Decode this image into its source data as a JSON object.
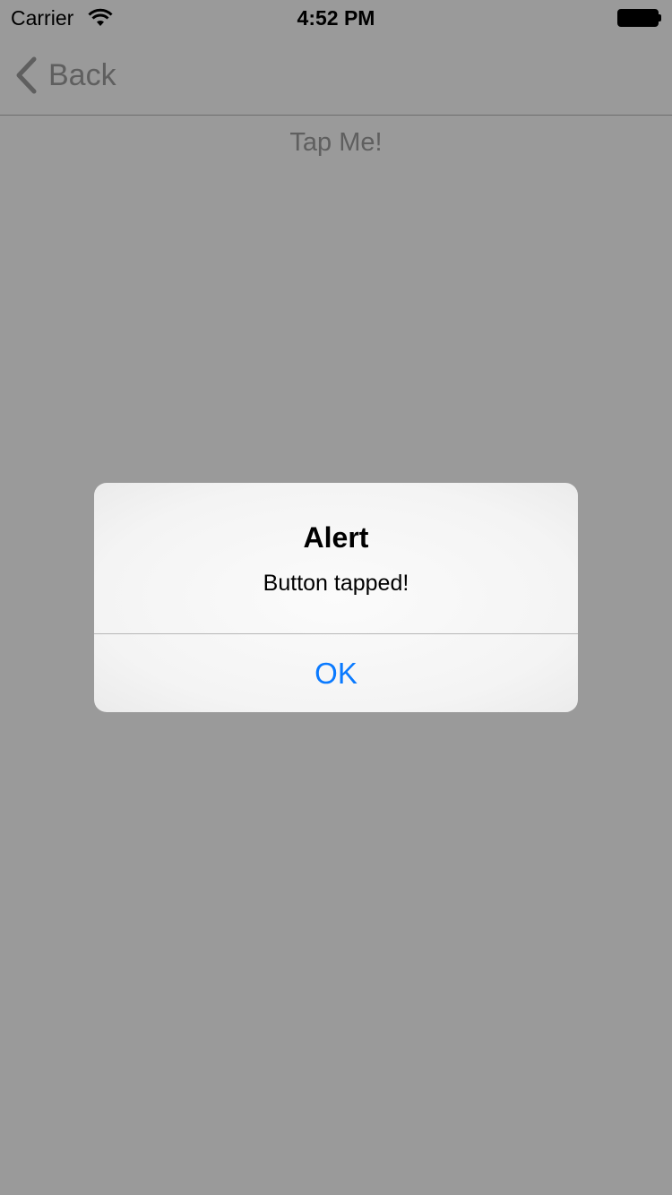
{
  "status_bar": {
    "carrier": "Carrier",
    "time": "4:52 PM",
    "wifi_icon": "wifi-icon",
    "battery_icon": "battery-icon"
  },
  "nav_bar": {
    "back_label": "Back",
    "back_icon": "chevron-left-icon"
  },
  "main": {
    "tap_me_label": "Tap Me!"
  },
  "alert": {
    "title": "Alert",
    "message": "Button tapped!",
    "ok_label": "OK"
  },
  "colors": {
    "dimmed_background": "#9a9a9a",
    "alert_background": "#f7f7f7",
    "ios_blue": "#0a7aff",
    "dimmed_text": "#5f5f5f"
  }
}
